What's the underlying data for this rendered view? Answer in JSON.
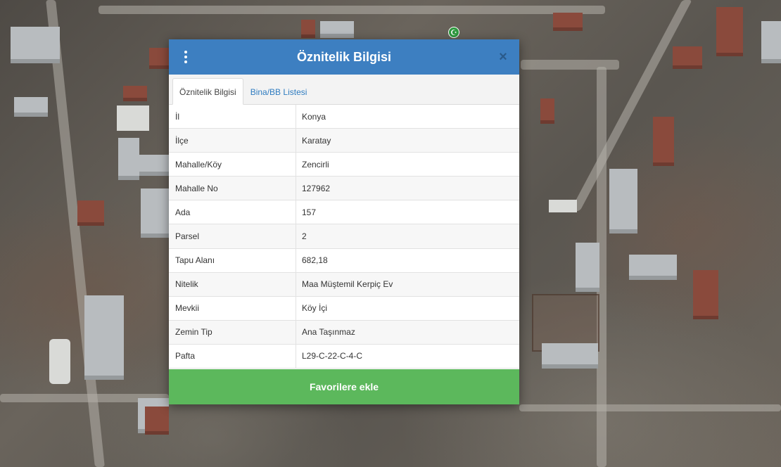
{
  "dialog": {
    "title": "Öznitelik Bilgisi",
    "menu_icon": "vertical-dots-icon",
    "close_icon": "close-icon"
  },
  "tabs": [
    {
      "label": "Öznitelik Bilgisi",
      "active": true
    },
    {
      "label": "Bina/BB Listesi",
      "active": false
    }
  ],
  "attributes": [
    {
      "key": "İl",
      "value": "Konya"
    },
    {
      "key": "İlçe",
      "value": "Karatay"
    },
    {
      "key": "Mahalle/Köy",
      "value": "Zencirli"
    },
    {
      "key": "Mahalle No",
      "value": "127962"
    },
    {
      "key": "Ada",
      "value": "157"
    },
    {
      "key": "Parsel",
      "value": "2"
    },
    {
      "key": "Tapu Alanı",
      "value": "682,18"
    },
    {
      "key": "Nitelik",
      "value": "Maa Müştemil Kerpiç Ev"
    },
    {
      "key": "Mevkii",
      "value": "Köy İçi"
    },
    {
      "key": "Zemin Tip",
      "value": "Ana Taşınmaz"
    },
    {
      "key": "Pafta",
      "value": "L29-C-22-C-4-C"
    }
  ],
  "actions": {
    "favorite_label": "Favorilere ekle"
  },
  "map": {
    "marker_icon": "mosque-marker-icon"
  },
  "colors": {
    "header": "#3d7fc1",
    "tab_link": "#2f7cc0",
    "favorite_button": "#5cb85c",
    "marker": "#2e9a3f"
  }
}
